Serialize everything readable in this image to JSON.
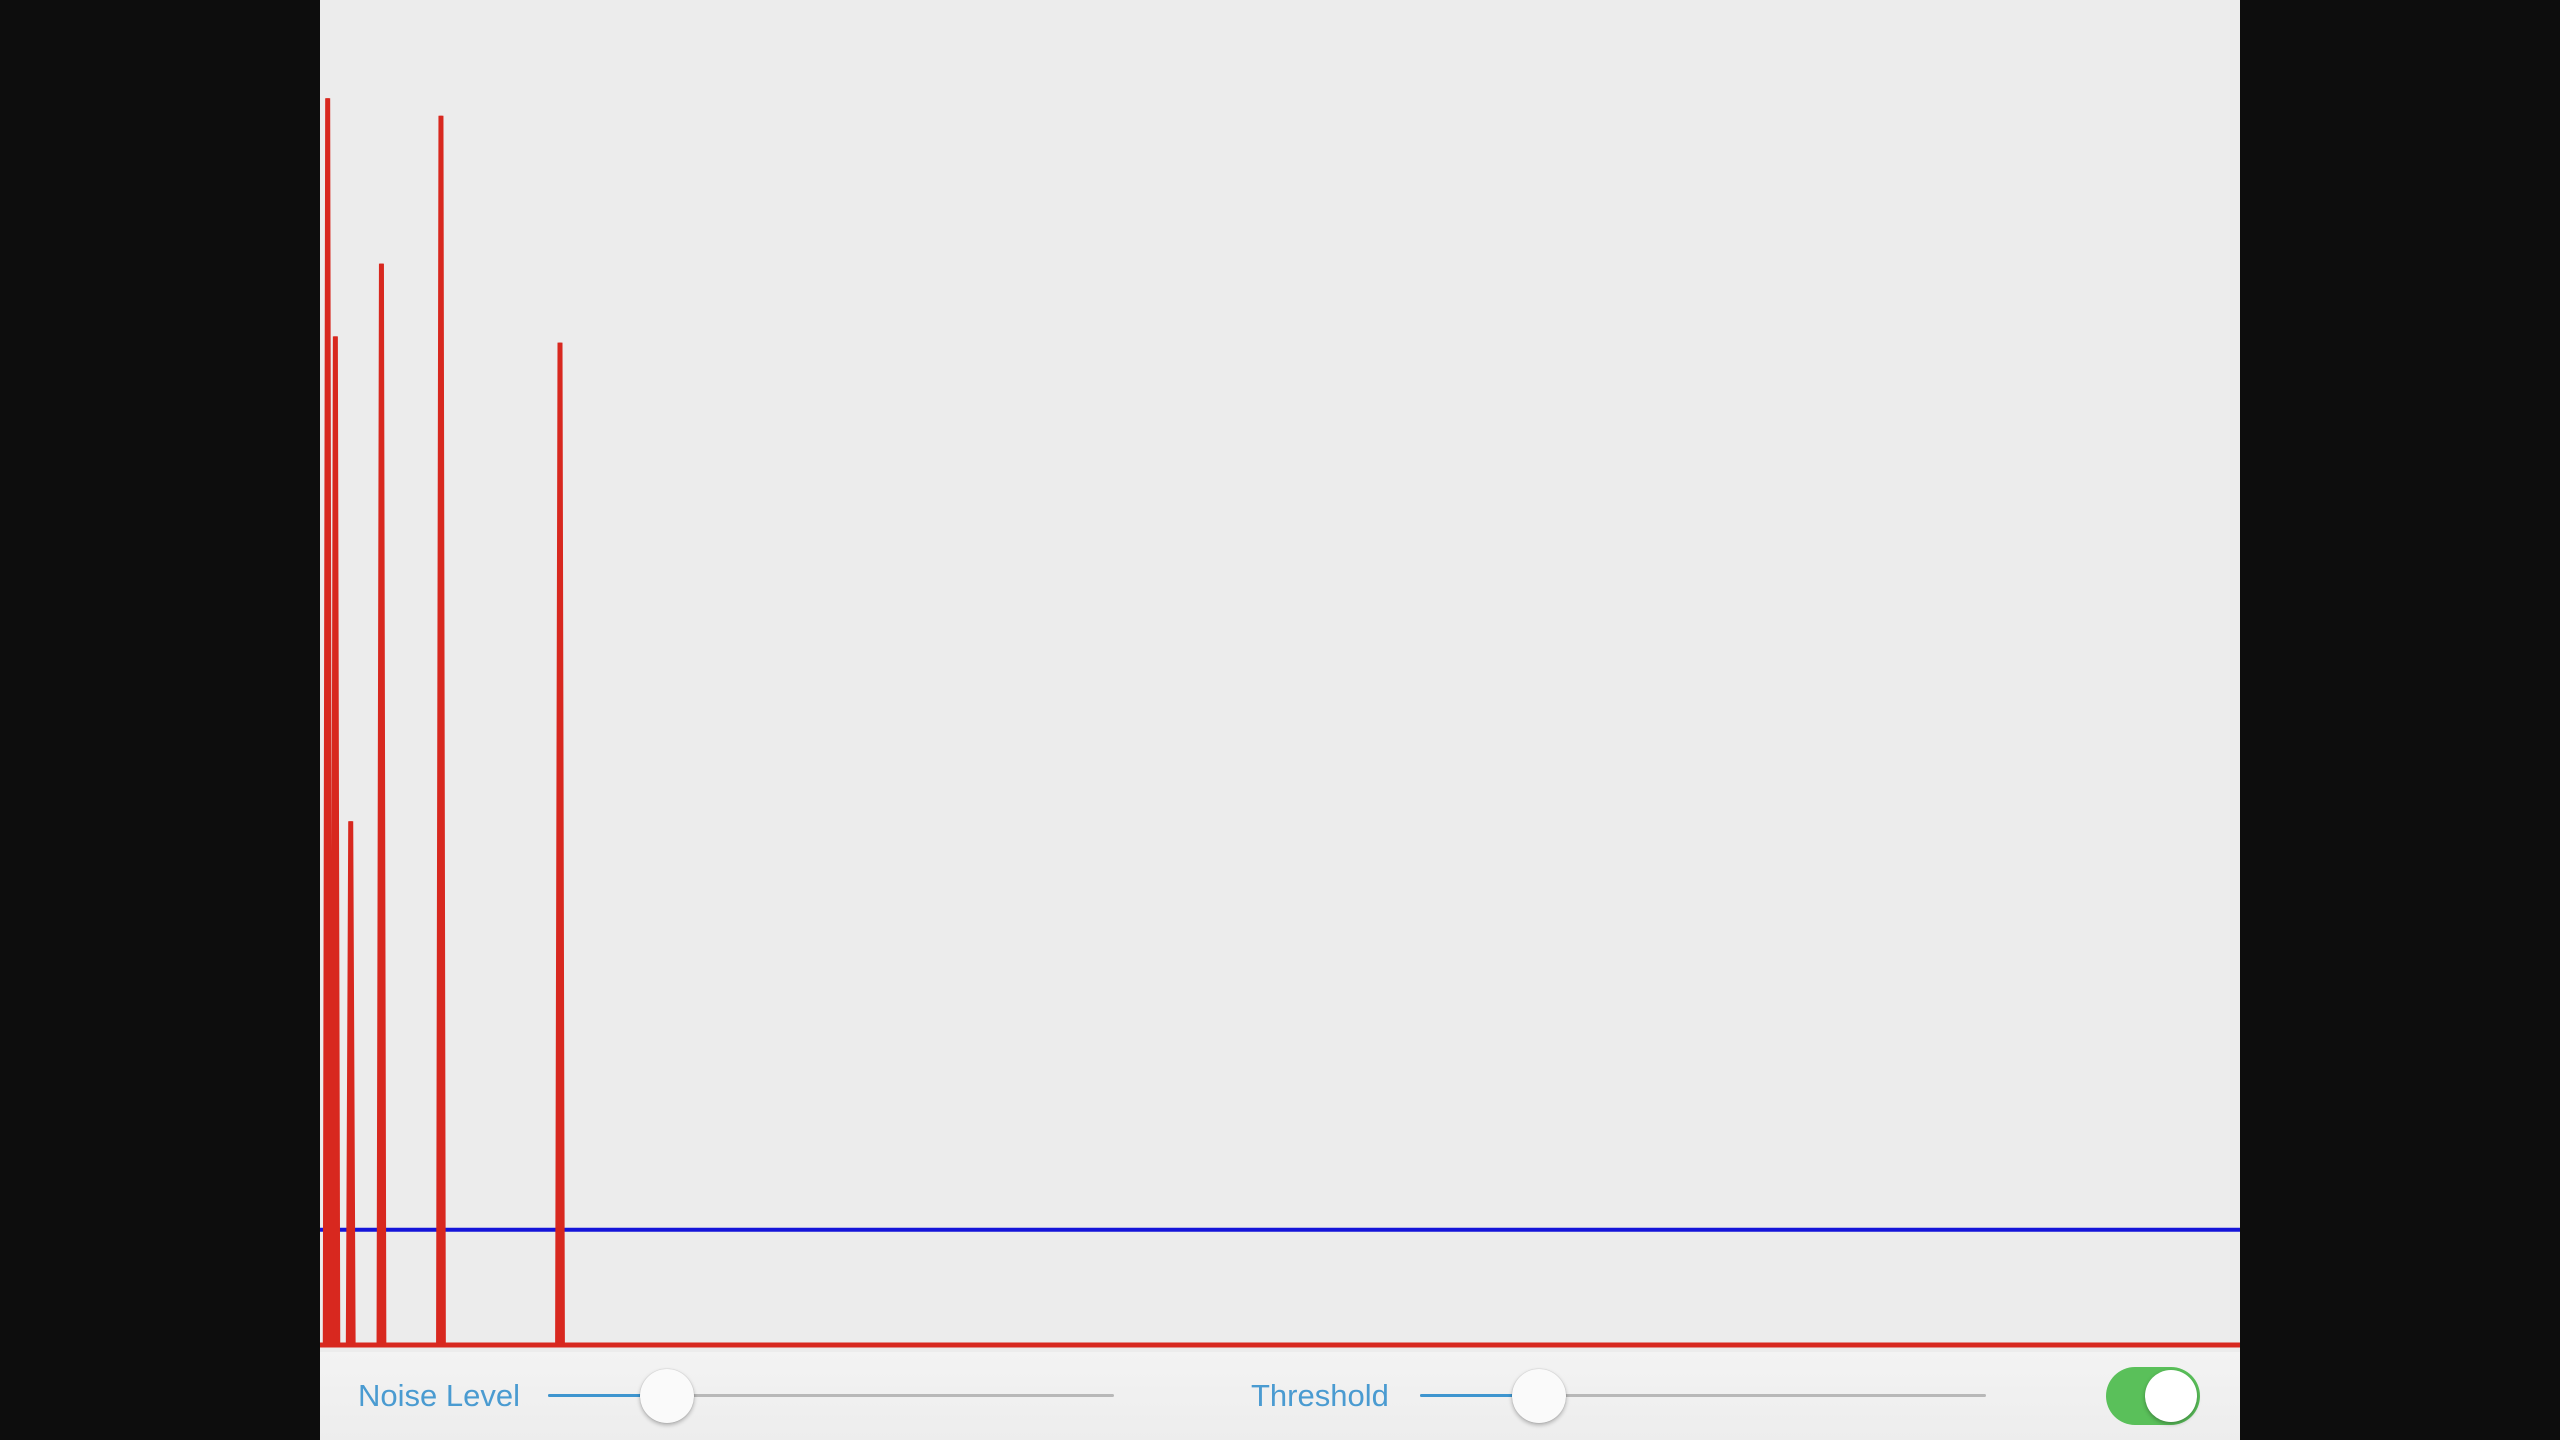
{
  "colors": {
    "signal": "#d8281f",
    "threshold_line": "#1515d9",
    "control_tint": "#4a9bd1",
    "toggle_on": "#5ac05a",
    "background": "#ececec"
  },
  "chart_data": {
    "type": "line",
    "x_range": [
      0,
      1000
    ],
    "y_range": [
      0,
      1
    ],
    "threshold": 0.092,
    "spikes": [
      {
        "x": 4,
        "y": 0.995
      },
      {
        "x": 8,
        "y": 0.805
      },
      {
        "x": 16,
        "y": 0.418
      },
      {
        "x": 32,
        "y": 0.863
      },
      {
        "x": 63,
        "y": 0.981
      },
      {
        "x": 125,
        "y": 0.8
      }
    ]
  },
  "controls": {
    "noise_level": {
      "label": "Noise Level",
      "value": 0.21
    },
    "threshold": {
      "label": "Threshold",
      "value": 0.21
    },
    "toggle": {
      "state": "on"
    }
  }
}
